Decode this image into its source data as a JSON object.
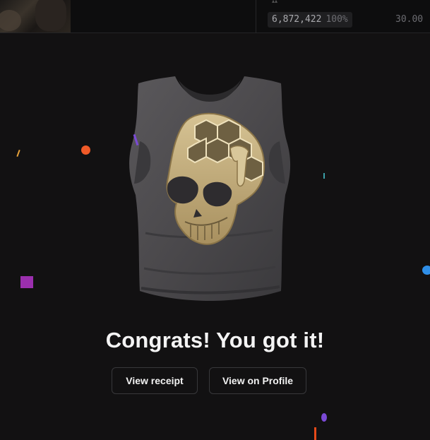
{
  "top_stats": {
    "count": "6,872,422",
    "percent": "100%",
    "price": "30.00"
  },
  "result": {
    "title": "Congrats! You got it!"
  },
  "actions": {
    "view_receipt": "View receipt",
    "view_profile": "View on Profile"
  },
  "item": {
    "image": "distressed-tank-top-with-gold-honeycomb-skull",
    "colors": {
      "shirt": "#4f4d50",
      "print": "#c7b283"
    }
  },
  "theme": {
    "background": "#121112",
    "button_border": "#38383b",
    "confetti": [
      "#f05a28",
      "#9b2fae",
      "#2f8fe8",
      "#7b4ad6",
      "#e8a23a",
      "#e64a19",
      "#5b4ae0"
    ]
  }
}
